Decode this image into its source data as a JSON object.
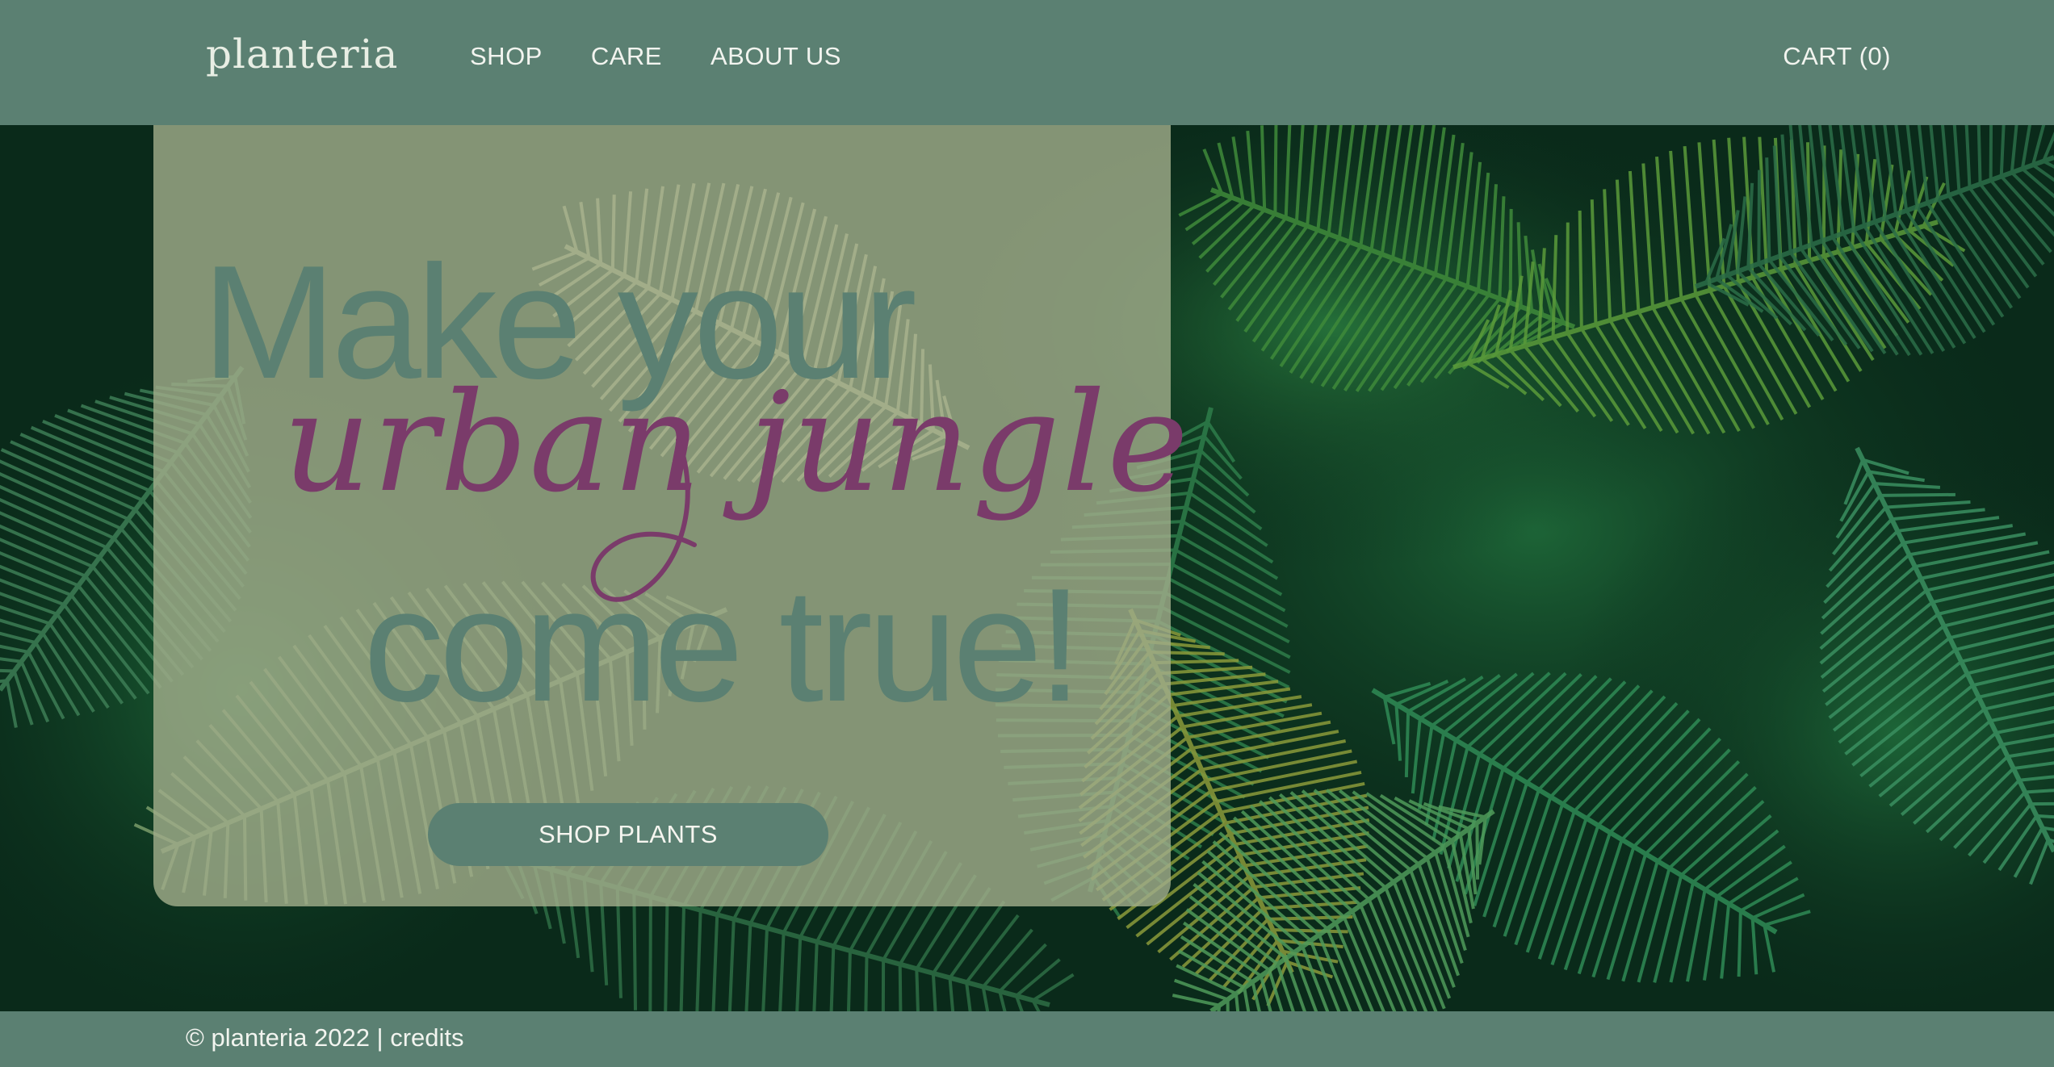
{
  "header": {
    "logo": "planteria",
    "nav": [
      "SHOP",
      "CARE",
      "ABOUT US"
    ],
    "cart": "CART (0)"
  },
  "hero": {
    "line1": "Make your",
    "line2": "urban jungle",
    "line3": "come true!",
    "button": "SHOP PLANTS"
  },
  "footer": {
    "copyright": "© planteria 2022 |",
    "credits": "credits"
  },
  "colors": {
    "brand_green": "#5b8072",
    "card_overlay": "#a0ac8a",
    "script_accent": "#7a3b6a",
    "jungle_dark": "#0a2a1a"
  },
  "icons": {
    "background": "palm-leaves-photo"
  }
}
